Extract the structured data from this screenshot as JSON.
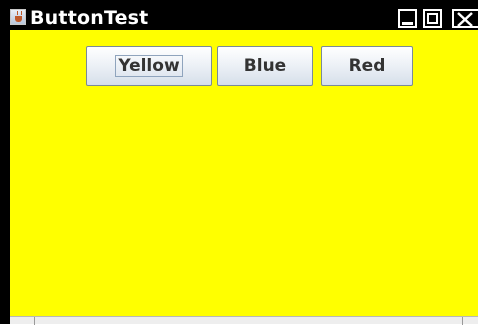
{
  "window": {
    "title": "ButtonTest",
    "icon": "java-cup-icon",
    "controls": [
      "minimize-icon",
      "maximize-icon",
      "close-icon"
    ]
  },
  "panel": {
    "background_color": "#ffff00",
    "buttons": [
      {
        "label": "Yellow",
        "focused": true
      },
      {
        "label": "Blue",
        "focused": false
      },
      {
        "label": "Red",
        "focused": false
      }
    ]
  }
}
